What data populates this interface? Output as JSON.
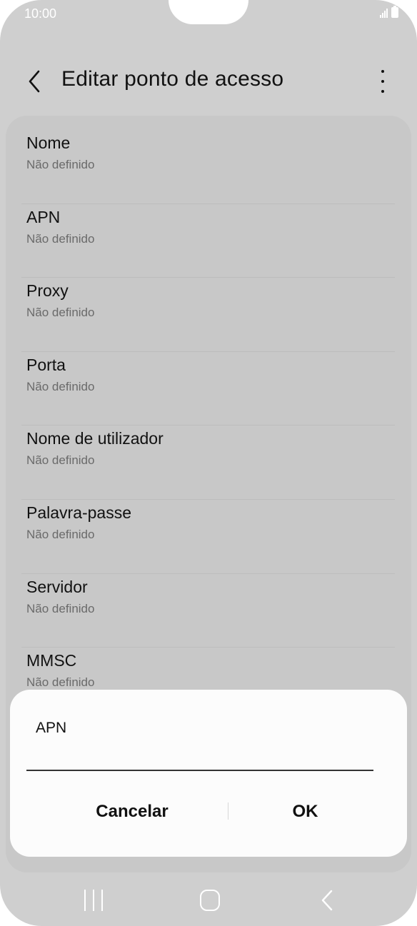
{
  "status_bar": {
    "time": "10:00"
  },
  "app_bar": {
    "title": "Editar ponto de acesso"
  },
  "settings": [
    {
      "label": "Nome",
      "value": "Não definido"
    },
    {
      "label": "APN",
      "value": "Não definido"
    },
    {
      "label": "Proxy",
      "value": "Não definido"
    },
    {
      "label": "Porta",
      "value": "Não definido"
    },
    {
      "label": "Nome de utilizador",
      "value": "Não definido"
    },
    {
      "label": "Palavra-passe",
      "value": "Não definido"
    },
    {
      "label": "Servidor",
      "value": "Não definido"
    },
    {
      "label": "MMSC",
      "value": "Não definido"
    }
  ],
  "dialog": {
    "title": "APN",
    "input_value": "",
    "cancel_label": "Cancelar",
    "ok_label": "OK"
  },
  "icons": {
    "back": "chevron-left-icon",
    "more": "more-vertical-icon",
    "nav_recent": "recent-apps-icon",
    "nav_home": "home-icon",
    "nav_back": "back-icon"
  }
}
